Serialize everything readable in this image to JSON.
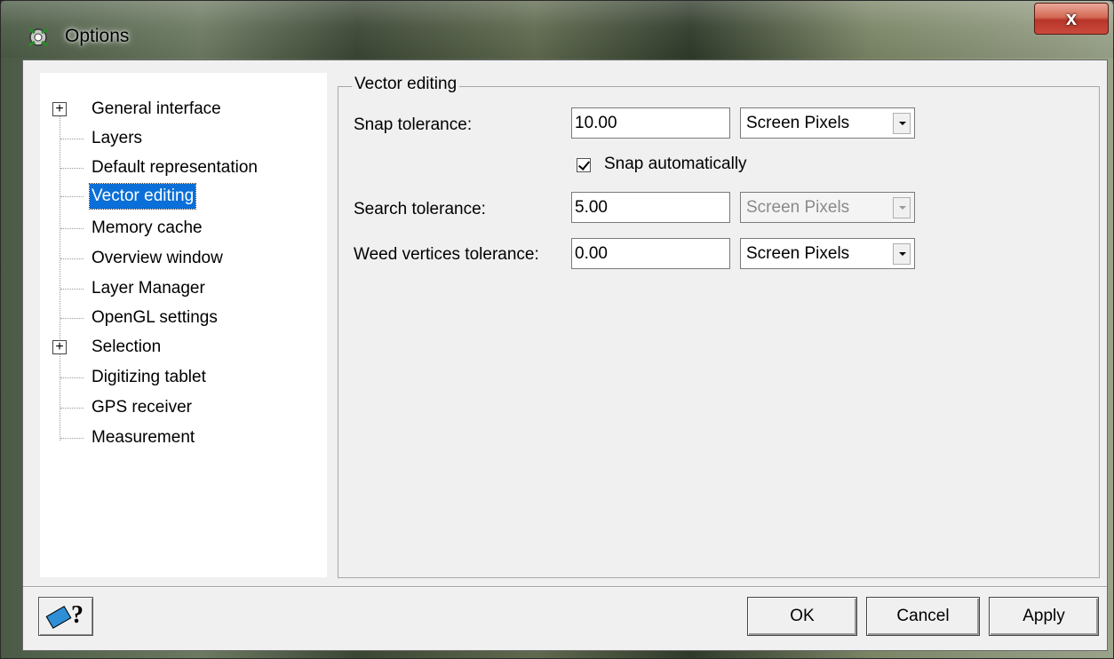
{
  "window": {
    "title": "Options",
    "close_label": "x"
  },
  "tree": {
    "items": [
      {
        "label": "General interface",
        "expandable": true
      },
      {
        "label": "Layers",
        "expandable": false
      },
      {
        "label": "Default representation",
        "expandable": false
      },
      {
        "label": "Vector editing",
        "expandable": false,
        "selected": true
      },
      {
        "label": "Memory cache",
        "expandable": false
      },
      {
        "label": "Overview window",
        "expandable": false
      },
      {
        "label": "Layer Manager",
        "expandable": false
      },
      {
        "label": "OpenGL settings",
        "expandable": false
      },
      {
        "label": "Selection",
        "expandable": true
      },
      {
        "label": "Digitizing tablet",
        "expandable": false
      },
      {
        "label": "GPS receiver",
        "expandable": false
      },
      {
        "label": "Measurement",
        "expandable": false
      }
    ]
  },
  "panel": {
    "group_title": "Vector editing",
    "snap_label": "Snap tolerance:",
    "snap_value": "10.00",
    "snap_unit": "Screen Pixels",
    "snap_auto_label": "Snap automatically",
    "snap_auto_checked": true,
    "search_label": "Search tolerance:",
    "search_value": "5.00",
    "search_unit": "Screen Pixels",
    "weed_label": "Weed vertices tolerance:",
    "weed_value": "0.00",
    "weed_unit": "Screen Pixels"
  },
  "buttons": {
    "help": "?",
    "ok": "OK",
    "cancel": "Cancel",
    "apply": "Apply"
  }
}
